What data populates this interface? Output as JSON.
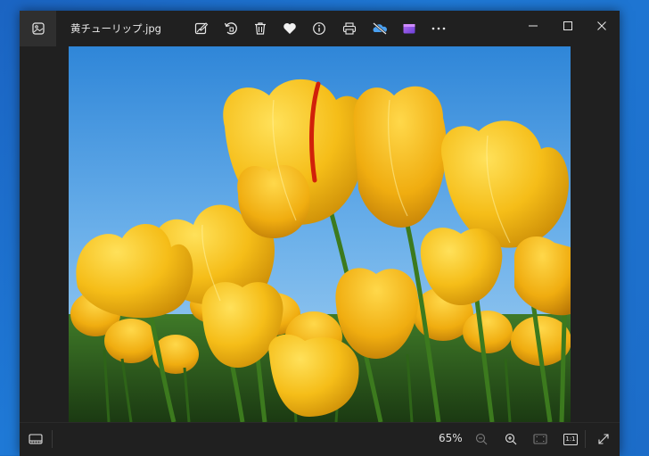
{
  "window": {
    "title": "黄チューリップ.jpg"
  },
  "toolbar": {
    "icons": [
      "edit-image-icon",
      "rotate-icon",
      "delete-icon",
      "favorite-heart-icon",
      "info-icon",
      "print-icon",
      "onedrive-icon",
      "clipchamp-icon",
      "more-icon"
    ]
  },
  "status": {
    "zoom": "65%",
    "actual_size_label": "1:1"
  },
  "colors": {
    "window_bg": "#202020",
    "desktop_bg": "#1b64c2",
    "text": "#e8e8e8"
  },
  "photo": {
    "subject": "黄チューリップ"
  }
}
